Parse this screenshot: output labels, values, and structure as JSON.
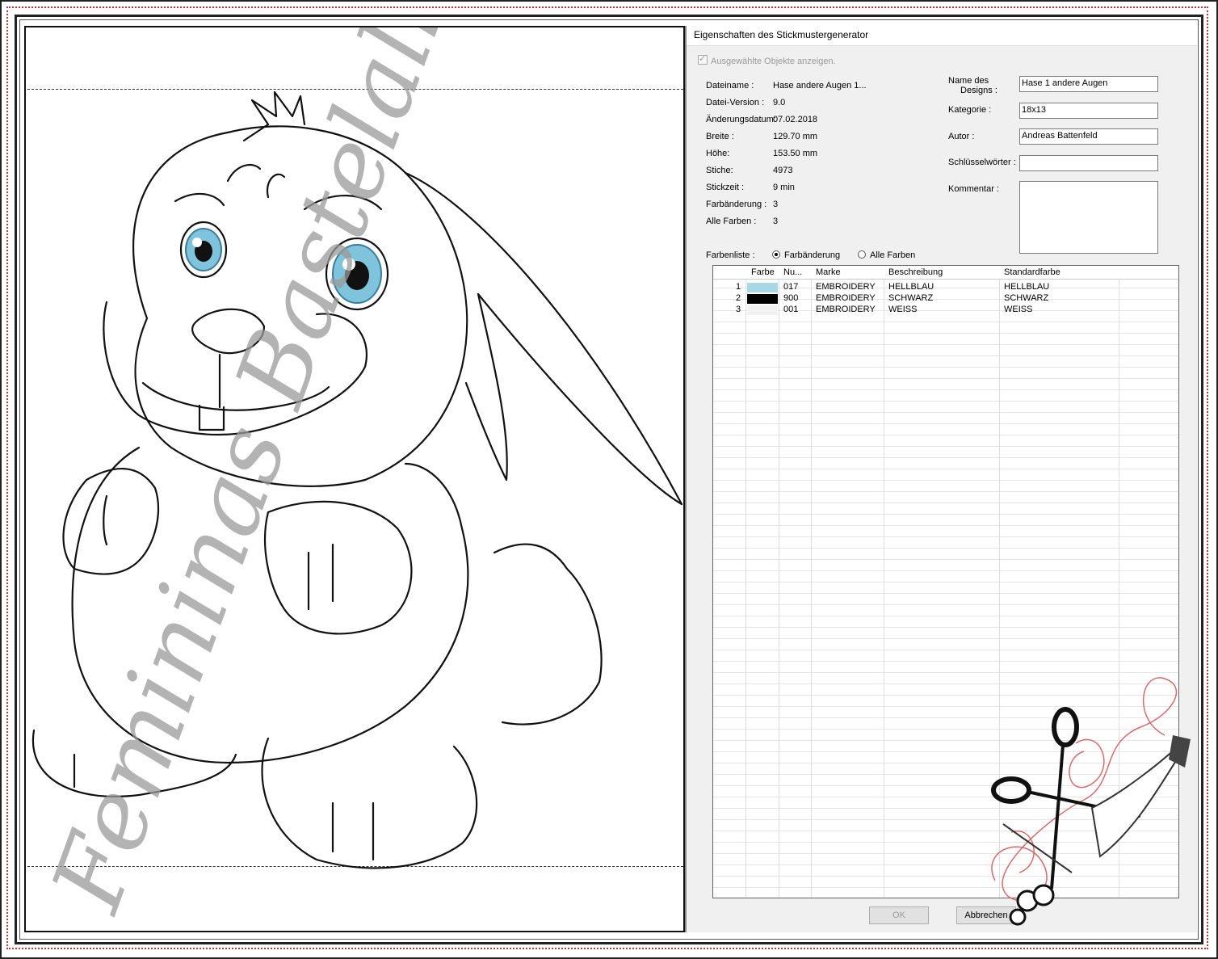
{
  "dialog": {
    "title": "Eigenschaften des Stickmustergenerator",
    "show_selected_label": "Ausgewählte Objekte anzeigen."
  },
  "info": [
    {
      "label": "Dateiname :",
      "value": "Hase andere Augen 1..."
    },
    {
      "label": "Datei-Version :",
      "value": "9.0"
    },
    {
      "label": "Änderungsdatum:",
      "value": "07.02.2018"
    },
    {
      "label": "Breite :",
      "value": "129.70 mm"
    },
    {
      "label": "Höhe:",
      "value": "153.50 mm"
    },
    {
      "label": "Stiche:",
      "value": "4973"
    },
    {
      "label": "Stickzeit :",
      "value": "9 min"
    },
    {
      "label": "Farbänderung :",
      "value": "3"
    },
    {
      "label": "Alle Farben :",
      "value": "3"
    }
  ],
  "fields": {
    "design_name_label_1": "Name des",
    "design_name_label_2": "Designs :",
    "design_name_value": "Hase 1 andere Augen",
    "category_label": "Kategorie :",
    "category_value": "18x13",
    "author_label": "Autor :",
    "author_value": "Andreas Battenfeld",
    "keywords_label": "Schlüsselwörter :",
    "keywords_value": "",
    "comment_label": "Kommentar :"
  },
  "colorlist": {
    "label": "Farbenliste :",
    "option_change": "Farbänderung",
    "option_all": "Alle Farben",
    "selected": "Farbänderung",
    "headers": [
      "Farbe",
      "Nu...",
      "Marke",
      "Beschreibung",
      "Standardfarbe"
    ],
    "rows": [
      {
        "index": "1",
        "color": "#a8d8e6",
        "number": "017",
        "brand": "EMBROIDERY",
        "description": "HELLBLAU",
        "standard": "HELLBLAU"
      },
      {
        "index": "2",
        "color": "#000000",
        "number": "900",
        "brand": "EMBROIDERY",
        "description": "SCHWARZ",
        "standard": "SCHWARZ"
      },
      {
        "index": "3",
        "color": "#f2f2f2",
        "number": "001",
        "brand": "EMBROIDERY",
        "description": "WEISS",
        "standard": "WEISS"
      }
    ]
  },
  "buttons": {
    "ok": "OK",
    "cancel": "Abbrechen"
  },
  "watermark": "Femininas Bastelallerlei",
  "colors": {
    "eye_blue": "#7fc4dc",
    "frame_red": "#cc3333"
  }
}
